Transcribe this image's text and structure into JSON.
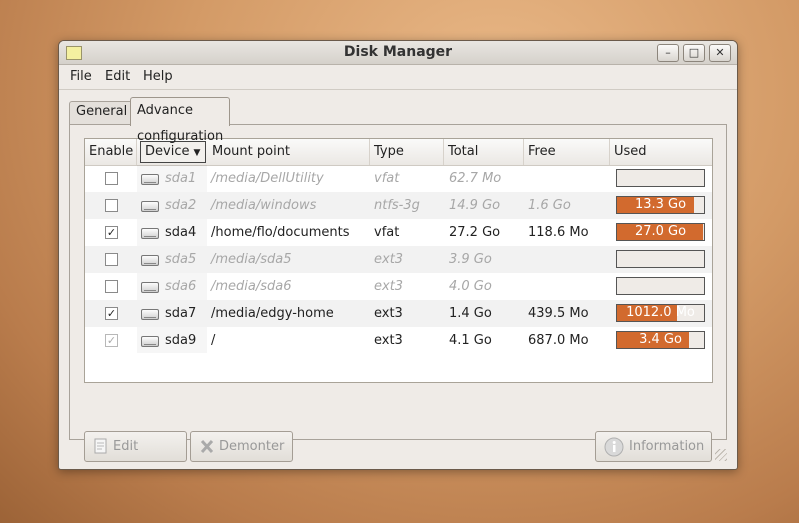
{
  "window": {
    "title": "Disk Manager"
  },
  "menu": {
    "file": "File",
    "edit": "Edit",
    "help": "Help"
  },
  "tabs": {
    "general": "General",
    "advanced": "Advance configuration"
  },
  "columns": {
    "enable": "Enable",
    "device": "Device",
    "mount": "Mount point",
    "type": "Type",
    "total": "Total",
    "free": "Free",
    "used": "Used"
  },
  "rows": [
    {
      "enabled": false,
      "active": false,
      "device": "sda1",
      "mount": "/media/DellUtility",
      "type": "vfat",
      "total": "62.7 Mo",
      "free": "",
      "used_label": "",
      "used_fraction": 0.0
    },
    {
      "enabled": false,
      "active": false,
      "device": "sda2",
      "mount": "/media/windows",
      "type": "ntfs-3g",
      "total": "14.9 Go",
      "free": "1.6 Go",
      "used_label": "13.3 Go",
      "used_fraction": 0.89
    },
    {
      "enabled": true,
      "active": true,
      "device": "sda4",
      "mount": "/home/flo/documents",
      "type": "vfat",
      "total": "27.2 Go",
      "free": "118.6 Mo",
      "used_label": "27.0 Go",
      "used_fraction": 0.99
    },
    {
      "enabled": false,
      "active": false,
      "device": "sda5",
      "mount": "/media/sda5",
      "type": "ext3",
      "total": "3.9 Go",
      "free": "",
      "used_label": "",
      "used_fraction": 0.0
    },
    {
      "enabled": false,
      "active": false,
      "device": "sda6",
      "mount": "/media/sda6",
      "type": "ext3",
      "total": "4.0 Go",
      "free": "",
      "used_label": "",
      "used_fraction": 0.0
    },
    {
      "enabled": true,
      "active": true,
      "device": "sda7",
      "mount": "/media/edgy-home",
      "type": "ext3",
      "total": "1.4 Go",
      "free": "439.5 Mo",
      "used_label": "1012.0 Mo",
      "used_fraction": 0.69
    },
    {
      "enabled": true,
      "active": true,
      "locked": true,
      "device": "sda9",
      "mount": "/",
      "type": "ext3",
      "total": "4.1 Go",
      "free": "687.0 Mo",
      "used_label": "3.4 Go",
      "used_fraction": 0.83
    }
  ],
  "buttons": {
    "edit": "Edit",
    "unmount": "Demonter",
    "information": "Information"
  },
  "colors": {
    "used_fill": "#d26a2e",
    "accent": "#e07a3c"
  }
}
